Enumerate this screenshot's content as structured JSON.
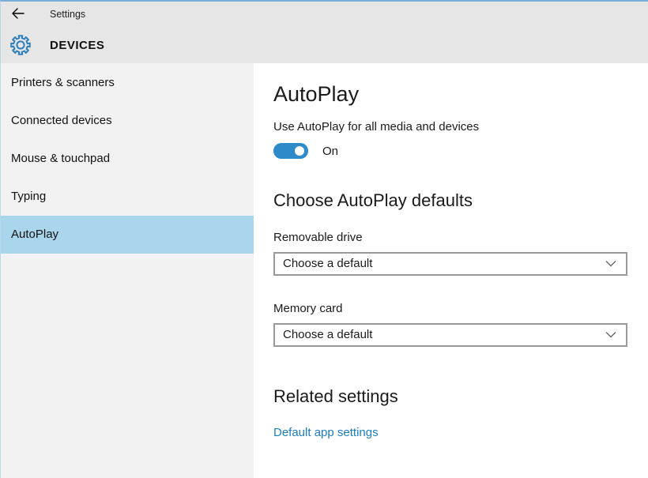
{
  "window": {
    "back_label": "Settings",
    "category": "DEVICES"
  },
  "sidebar": {
    "items": [
      {
        "label": "Printers & scanners",
        "selected": false
      },
      {
        "label": "Connected devices",
        "selected": false
      },
      {
        "label": "Mouse & touchpad",
        "selected": false
      },
      {
        "label": "Typing",
        "selected": false
      },
      {
        "label": "AutoPlay",
        "selected": true
      }
    ]
  },
  "main": {
    "title": "AutoPlay",
    "autoplay_toggle": {
      "label": "Use AutoPlay for all media and devices",
      "state": "On",
      "value": true
    },
    "defaults_heading": "Choose AutoPlay defaults",
    "dropdowns": [
      {
        "label": "Removable drive",
        "value": "Choose a default"
      },
      {
        "label": "Memory card",
        "value": "Choose a default"
      }
    ],
    "related_heading": "Related settings",
    "related_link": "Default app settings"
  },
  "icons": {
    "back": "back-arrow-icon",
    "gear": "gear-icon",
    "dropdown": "chevron-down-icon"
  },
  "colors": {
    "accent_toggle": "#2f8ac9",
    "selected_item_bg": "#a9d6ec",
    "link": "#1a7dbe",
    "topbar_bg": "#e6e6e6",
    "sidebar_bg": "#f2f2f2",
    "dropdown_border": "#999999",
    "window_border_top": "#79afd6",
    "gear_icon": "#2e7fbd"
  }
}
